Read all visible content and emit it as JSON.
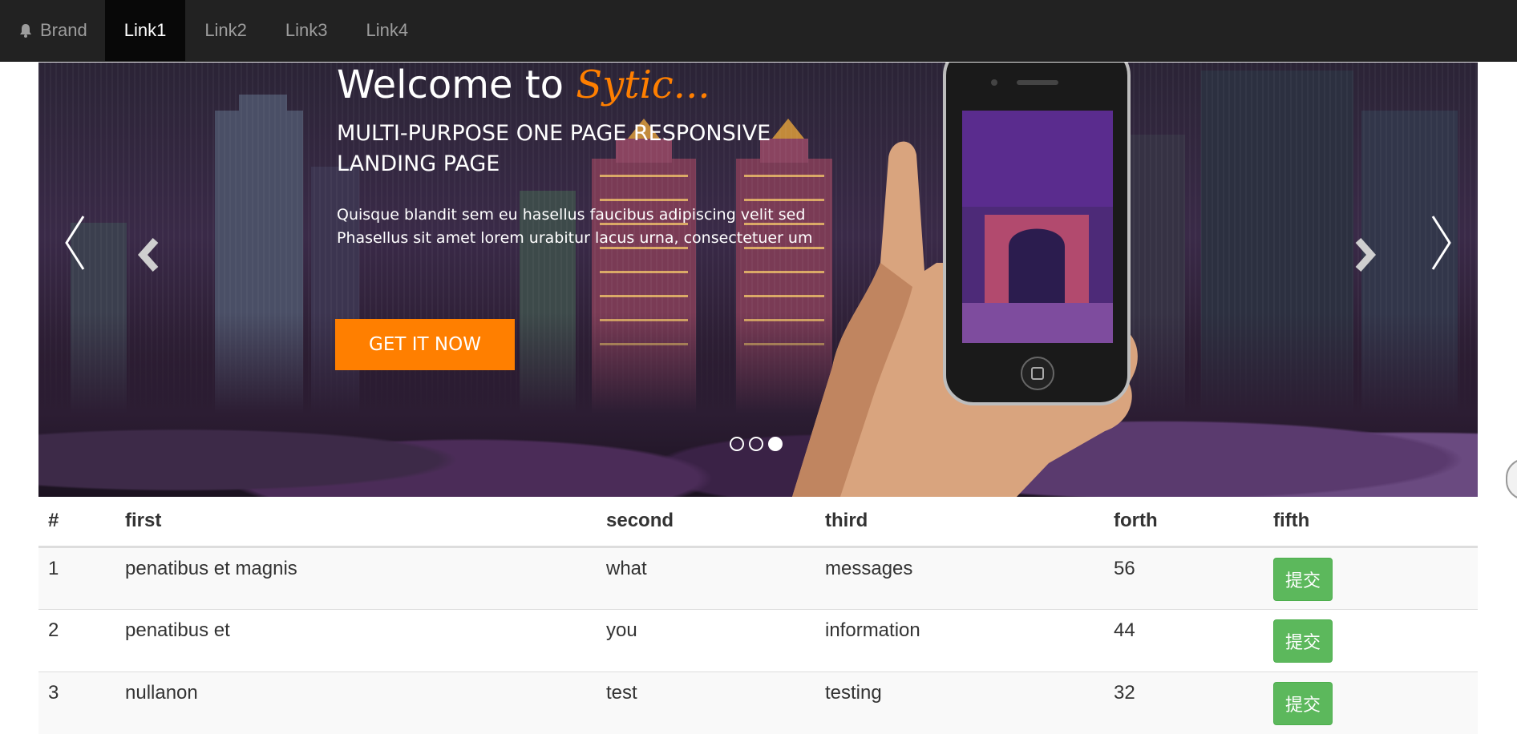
{
  "navbar": {
    "brand_label": "Brand",
    "brand_icon": "bell-icon",
    "links": [
      "Link1",
      "Link2",
      "Link3",
      "Link4"
    ],
    "active_link": "Link1"
  },
  "carousel": {
    "title_prefix": "Welcome to",
    "title_accent": "Sytic...",
    "subtitle": "MULTI-PURPOSE ONE PAGE RESPONSIVE LANDING PAGE",
    "text_line1": "Quisque blandit sem eu hasellus faucibus adipiscing velit sed",
    "text_line2": "Phasellus sit amet lorem urabitur lacus urna, consectetuer um",
    "cta_label": "GET IT NOW",
    "slide_count": 3,
    "active_slide": 3,
    "accent_color": "#ff7f00"
  },
  "table": {
    "headers": [
      "#",
      "first",
      "second",
      "third",
      "forth",
      "fifth"
    ],
    "rows": [
      {
        "num": "1",
        "first": "penatibus et magnis",
        "second": "what",
        "third": "messages",
        "forth": "56",
        "button": "提交"
      },
      {
        "num": "2",
        "first": "penatibus et",
        "second": "you",
        "third": "information",
        "forth": "44",
        "button": "提交"
      },
      {
        "num": "3",
        "first": "nullanon",
        "second": "test",
        "third": "testing",
        "forth": "32",
        "button": "提交"
      }
    ],
    "button_color": "#5cb85c"
  }
}
